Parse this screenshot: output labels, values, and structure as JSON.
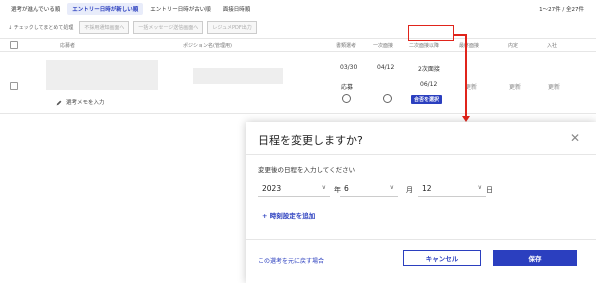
{
  "sort_tabs": [
    {
      "label": "選考が進んでいる順"
    },
    {
      "label": "エントリー日時が新しい順"
    },
    {
      "label": "エントリー日時が古い順"
    },
    {
      "label": "面接日時順"
    }
  ],
  "page_count": "1〜27件 / 全27件",
  "bulk": {
    "label": "↓ チェックしてまとめて処理",
    "buttons": [
      "不採用通知画面へ",
      "一括メッセージ送信画面へ",
      "レジュメPDF出力"
    ]
  },
  "table": {
    "headers": [
      "応募者",
      "ポジション名(管理用)",
      "書類選考",
      "一次面接",
      "二次面接以降",
      "最終面接",
      "内定",
      "入社"
    ]
  },
  "row": {
    "memo_label": "選考メモを入力",
    "doc_date": "03/30",
    "doc_status": "応募",
    "first_date": "04/12",
    "second_label": "2次面接",
    "second_date": "06/12",
    "second_badge": "合否を選択",
    "final": "更新",
    "offer": "更新",
    "join": "更新"
  },
  "modal": {
    "title": "日程を変更しますか?",
    "close_glyph": "✕",
    "instruction": "変更後の日程を入力してください",
    "year": "2023",
    "year_unit": "年",
    "month": "6",
    "month_unit": "月",
    "day": "12",
    "day_unit": "日",
    "add_special": "+ 時刻設定を追加",
    "revert_link": "この選考を元に戻す場合",
    "cancel_label": "キャンセル",
    "save_label": "保存"
  },
  "colors": {
    "accent": "#2b3fbf",
    "highlight": "#e0241b"
  }
}
